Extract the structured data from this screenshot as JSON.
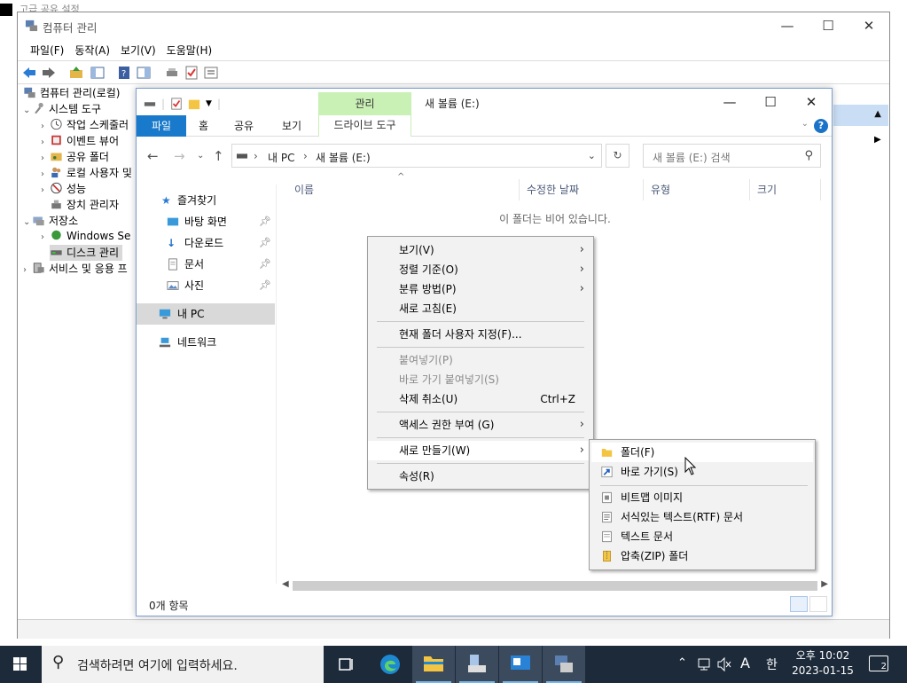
{
  "background_window": {
    "title": "고급 공유 설정"
  },
  "computer_management": {
    "title": "컴퓨터 관리",
    "menu": [
      "파일(F)",
      "동작(A)",
      "보기(V)",
      "도움말(H)"
    ],
    "tree": {
      "root": "컴퓨터 관리(로컬)",
      "system_tools": "시스템 도구",
      "task_scheduler": "작업 스케줄러",
      "event_viewer": "이벤트 뷰어",
      "shared_folders": "공유 폴더",
      "local_users": "로컬 사용자 및",
      "performance": "성능",
      "device_manager": "장치 관리자",
      "storage": "저장소",
      "windows_backup": "Windows Se",
      "disk_management": "디스크 관리",
      "services_apps": "서비스 및 응용 프"
    }
  },
  "explorer": {
    "title": "새 볼륨 (E:)",
    "manage_tab": "관리",
    "ribbon_tabs": {
      "file": "파일",
      "home": "홈",
      "share": "공유",
      "view": "보기",
      "drive_tools": "드라이브 도구"
    },
    "breadcrumb": [
      "내 PC",
      "새 볼륨 (E:)"
    ],
    "search_placeholder": "새 볼륨 (E:) 검색",
    "nav": {
      "quick_access": "즐겨찾기",
      "desktop": "바탕 화면",
      "downloads": "다운로드",
      "documents": "문서",
      "pictures": "사진",
      "this_pc": "내 PC",
      "network": "네트워크"
    },
    "columns": {
      "name": "이름",
      "date": "수정한 날짜",
      "type": "유형",
      "size": "크기"
    },
    "empty_message": "이 폴더는 비어 있습니다.",
    "status": "0개 항목"
  },
  "context_menu": {
    "view": "보기(V)",
    "sort": "정렬 기준(O)",
    "group": "분류 방법(P)",
    "refresh": "새로 고침(E)",
    "customize": "현재 폴더 사용자 지정(F)...",
    "paste": "붙여넣기(P)",
    "paste_shortcut": "바로 가기 붙여넣기(S)",
    "undo_delete": "삭제 취소(U)",
    "undo_shortcut": "Ctrl+Z",
    "give_access": "액세스 권한 부여 (G)",
    "new": "새로 만들기(W)",
    "properties": "속성(R)"
  },
  "new_submenu": {
    "folder": "폴더(F)",
    "shortcut": "바로 가기(S)",
    "bitmap": "비트맵 이미지",
    "rtf": "서식있는 텍스트(RTF) 문서",
    "text": "텍스트 문서",
    "zip": "압축(ZIP) 폴더"
  },
  "taskbar": {
    "search_placeholder": "검색하려면 여기에 입력하세요.",
    "ime": "A",
    "ime2": "한",
    "time": "오후 10:02",
    "date": "2023-01-15",
    "notifications": "2"
  },
  "colors": {
    "file_tab": "#1979ca",
    "manage_tab": "#c9f0b5",
    "taskbar": "#1c2a3a",
    "menu_bg": "#f2f2f2"
  }
}
